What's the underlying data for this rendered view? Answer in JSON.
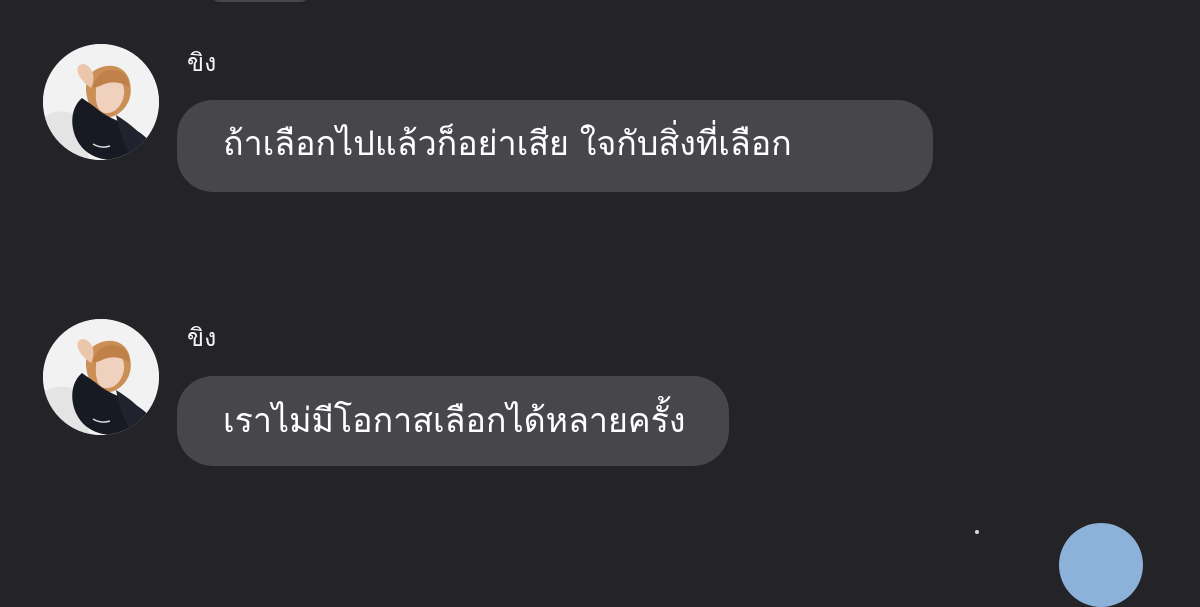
{
  "messages": [
    {
      "sender": "ขิง",
      "text": "ถ้าเลือกไปแล้วก็อย่าเสีย ใจกับสิ่งที่เลือก"
    },
    {
      "sender": "ขิง",
      "text": "เราไม่มีโอกาสเลือกได้หลายครั้ง"
    }
  ]
}
